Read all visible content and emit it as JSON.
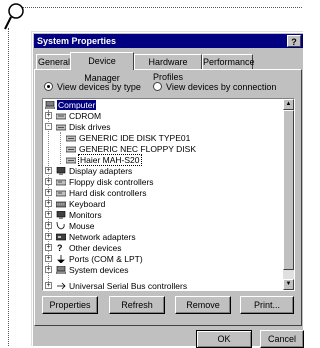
{
  "window": {
    "title": "System Properties",
    "help_button": "?"
  },
  "tabs": [
    {
      "label": "General",
      "active": false
    },
    {
      "label": "Device Manager",
      "active": true
    },
    {
      "label": "Hardware Profiles",
      "active": false
    },
    {
      "label": "Performance",
      "active": false
    }
  ],
  "view_options": {
    "by_type": "View devices by type",
    "by_connection": "View devices by connection",
    "selected": "by_type"
  },
  "tree": [
    {
      "label": "Computer",
      "expander": "",
      "icon": "computer-icon",
      "state": "selected"
    },
    {
      "label": "CDROM",
      "expander": "+",
      "icon": "cdrom-icon"
    },
    {
      "label": "Disk drives",
      "expander": "-",
      "icon": "disk-drive-icon"
    },
    {
      "label": "GENERIC IDE  DISK TYPE01",
      "expander": "",
      "icon": "disk-drive-icon"
    },
    {
      "label": "GENERIC NEC  FLOPPY DISK",
      "expander": "",
      "icon": "disk-drive-icon"
    },
    {
      "label": "Haier MAH-S20",
      "expander": "",
      "icon": "disk-drive-icon",
      "state": "focused"
    },
    {
      "label": "Display adapters",
      "expander": "+",
      "icon": "display-adapter-icon"
    },
    {
      "label": "Floppy disk controllers",
      "expander": "+",
      "icon": "floppy-controller-icon"
    },
    {
      "label": "Hard disk controllers",
      "expander": "+",
      "icon": "hard-disk-controller-icon"
    },
    {
      "label": "Keyboard",
      "expander": "+",
      "icon": "keyboard-icon"
    },
    {
      "label": "Monitors",
      "expander": "+",
      "icon": "monitor-icon"
    },
    {
      "label": "Mouse",
      "expander": "+",
      "icon": "mouse-icon"
    },
    {
      "label": "Network adapters",
      "expander": "+",
      "icon": "network-adapter-icon"
    },
    {
      "label": "Other devices",
      "expander": "+",
      "icon": "question-icon"
    },
    {
      "label": "Ports (COM & LPT)",
      "expander": "+",
      "icon": "port-icon"
    },
    {
      "label": "System devices",
      "expander": "+",
      "icon": "system-devices-icon"
    },
    {
      "label": "Universal Serial Bus controllers",
      "expander": "+",
      "icon": "usb-icon"
    }
  ],
  "buttons": {
    "properties": "Properties",
    "refresh": "Refresh",
    "remove": "Remove",
    "print": "Print...",
    "ok": "OK",
    "cancel": "Cancel"
  },
  "colors": {
    "title_bar": "#000080",
    "selection": "#000080",
    "window_face": "#c0c0c0"
  }
}
